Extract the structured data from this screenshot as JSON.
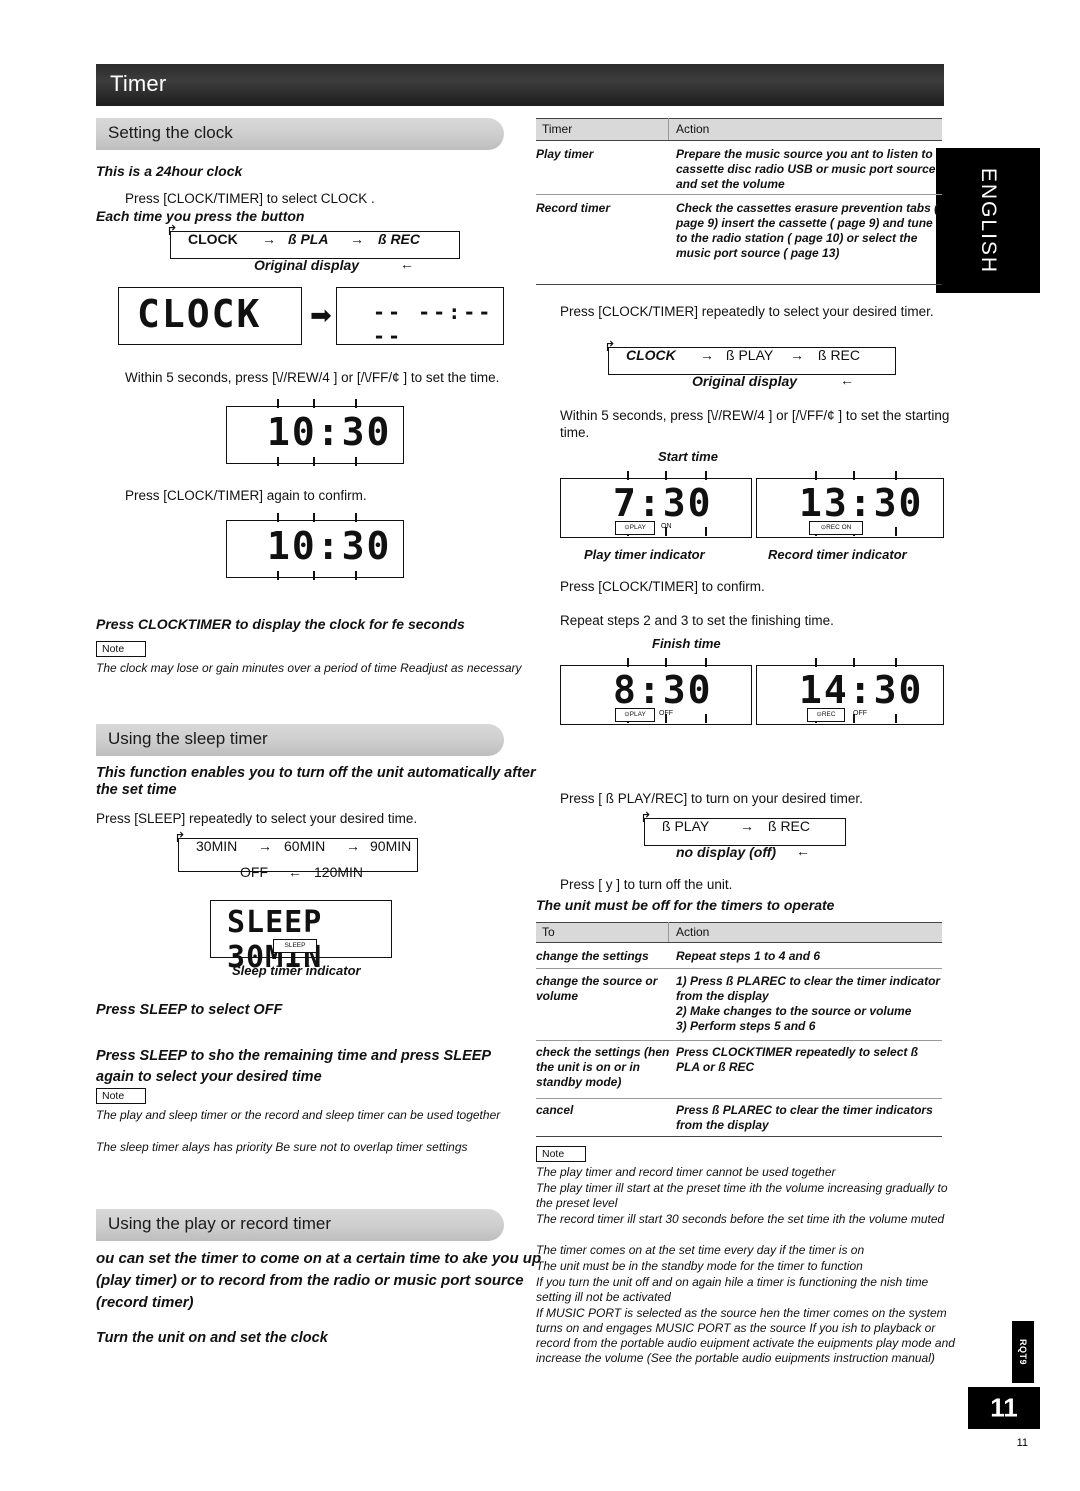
{
  "page": {
    "title": "Timer",
    "number": "11",
    "language_tab": "ENGLISH",
    "side_code": "RQT9"
  },
  "left": {
    "sections": [
      {
        "id": "clock",
        "label": "Setting the clock"
      },
      {
        "id": "sleep",
        "label": "Using the sleep timer"
      },
      {
        "id": "playrec",
        "label": "Using the play or record timer"
      }
    ],
    "clock": {
      "subtitle": "This is a 24hour clock",
      "step1": "Press [CLOCK/TIMER] to select  CLOCK .",
      "each_time": "Each time you press the button",
      "flow": [
        "CLOCK",
        "ß PLA",
        "ß REC"
      ],
      "original_display": "Original display",
      "display_clock": "CLOCK",
      "display_blank": "-- --:-- --",
      "step2": "Within 5 seconds, press   [\\//REW/4    ] or [/\\/FF/¢    ]  to set the time.",
      "display_time1": "10:30",
      "step3": "Press [CLOCK/TIMER] again to confirm.",
      "display_time2": "10:30",
      "tip": "Press CLOCKTIMER to display the clock for fe seconds",
      "note_label": "Note",
      "note": "The clock may lose or gain minutes over a period of time Readjust as necessary"
    },
    "sleep": {
      "intro": "This function enables you to turn off the unit automatically after the set time",
      "step1": "Press [SLEEP] repeatedly to select your desired time.",
      "options_row1": [
        "30MIN",
        "60MIN",
        "90MIN"
      ],
      "options_row2": [
        "OFF",
        "120MIN"
      ],
      "display_text": "SLEEP 30MIN",
      "display_badge": "SLEEP",
      "display_caption": "Sleep timer indicator",
      "tip1": "Press SLEEP to select OFF",
      "tip2": "Press  SLEEP  to  sho   the  remaining  time  and  press SLEEP again to select your desired time",
      "note_label": "Note",
      "notes": [
        "The play and sleep timer or the record and sleep timer can be used together",
        "The sleep timer alays has priority Be sure not to overlap timer settings"
      ]
    },
    "playrec": {
      "intro": "ou can set the timer to come on at a certain time to ake you up (play timer) or to record from the radio or music port source (record timer)",
      "step1": "Turn the unit on and set the clock"
    }
  },
  "right": {
    "table1": {
      "headers": [
        "Timer",
        "Action"
      ],
      "rows": [
        {
          "timer": "Play timer",
          "action": "Prepare the music source you ant to listen to cassette disc radio USB or music port source and set the volume"
        },
        {
          "timer": "Record timer",
          "action": "Check the cassettes erasure prevention tabs (    page 9) insert the cassette (    page 9) and tune to the radio station (    page 10) or select the music port source (    page 13)"
        }
      ]
    },
    "step2": "Press [CLOCK/TIMER] repeatedly to select your desired timer.",
    "flow": [
      "CLOCK",
      "ß PLAY",
      "ß REC"
    ],
    "original_display": "Original display",
    "step3": "Within 5 seconds, press   [\\//REW/4    ] or [/\\/FF/¢    ]  to set the starting time.",
    "start_time_label": "Start time",
    "start_displays": [
      {
        "value": "7:30",
        "badge": "⊙PLAY",
        "state": "ON",
        "caption": "Play timer indicator"
      },
      {
        "value": "13:30",
        "badge": "⊙REC ON",
        "state": "",
        "caption": "Record timer indicator"
      }
    ],
    "step4": "Press [CLOCK/TIMER] to confirm.",
    "step5": "Repeat steps 2 and 3 to set the finishing time.",
    "finish_time_label": "Finish time",
    "finish_displays": [
      {
        "value": "8:30",
        "badge": "⊙PLAY",
        "state": "OFF"
      },
      {
        "value": "14:30",
        "badge": "⊙REC",
        "state": "OFF"
      }
    ],
    "step6": "Press [ ß PLAY/REC] to turn on your desired timer.",
    "flow2": [
      "ß PLAY",
      "ß REC"
    ],
    "no_display": "no display (off)",
    "step7": "Press [ y ] to turn off the unit.",
    "must_be_off": "The unit must be off for the timers to operate",
    "table2": {
      "headers": [
        "To",
        "Action"
      ],
      "rows": [
        {
          "to": "change the settings",
          "action": "Repeat steps 1 to 4 and 6"
        },
        {
          "to": "change the source or volume",
          "action": "1) Press ß PLAREC to clear the timer      indicator from the display\n2) Make changes to the source or volume\n3) Perform steps 5 and 6"
        },
        {
          "to": "check the settings (hen the unit is on or in standby mode)",
          "action": "Press CLOCKTIMER repeatedly to select ß PLA or  ß REC"
        },
        {
          "to": "cancel",
          "action": "Press ß PLAREC to clear the timer indicators from the display"
        }
      ]
    },
    "note_label": "Note",
    "notes": [
      "The play timer and record timer cannot be used together",
      "The  play  timer  ill  start  at  the  preset  time  ith  the  volume increasing gradually to the preset level",
      "The record timer ill start 30 seconds before the set time ith the volume muted",
      "The timer comes on at the set time every day if the timer is on",
      "The unit must be in the standby mode for the timer to function",
      "If you turn the unit off and on again hile a timer is functioning the nish time setting ill not be activated",
      "If MUSIC PORT is selected as the source hen the timer comes on the system turns on and engages MUSIC PORT as the source If you ish to playback or record from the portable audio euipment activate the euipments play mode and increase the volume (See the portable audio euipments instruction manual)"
    ]
  }
}
